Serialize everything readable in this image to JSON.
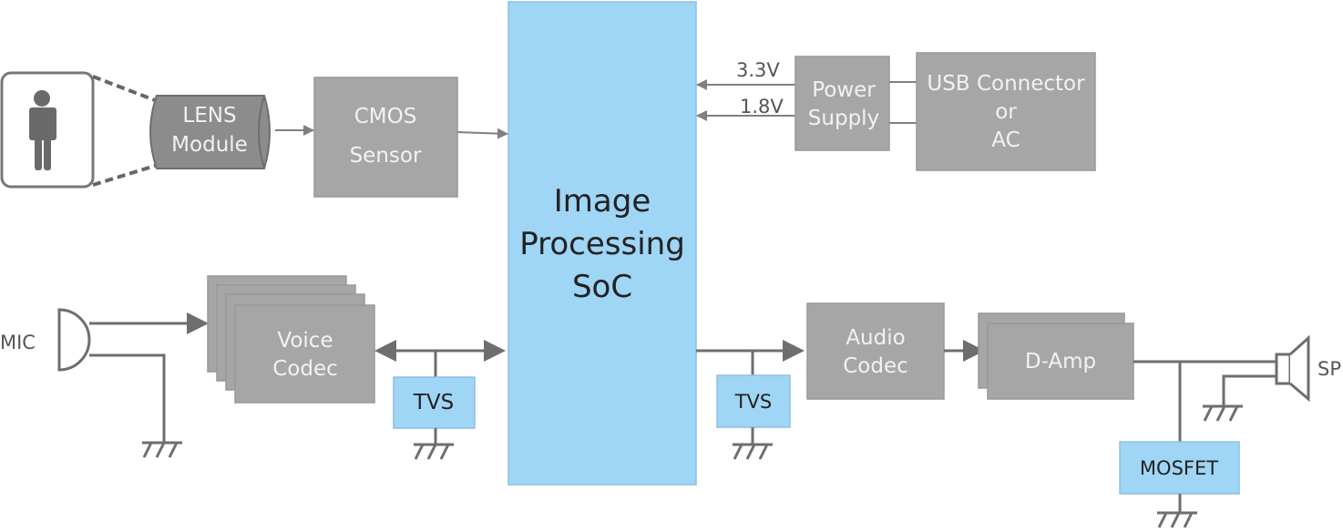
{
  "colors": {
    "block_gray": "#a6a6a6",
    "block_blue": "#9fd5f5",
    "line": "#6e6e6e"
  },
  "blocks": {
    "lens": [
      "LENS",
      "Module"
    ],
    "cmos": [
      "CMOS",
      "Sensor"
    ],
    "soc": [
      "Image",
      "Processing",
      "SoC"
    ],
    "power": [
      "Power",
      "Supply"
    ],
    "usb": [
      "USB Connector",
      "or",
      "AC"
    ],
    "voice_codec": [
      "Voice",
      "Codec"
    ],
    "tvs_left": "TVS",
    "tvs_right": "TVS",
    "audio_codec": [
      "Audio",
      "Codec"
    ],
    "damp": "D-Amp",
    "mosfet": "MOSFET"
  },
  "labels": {
    "v33": "3.3V",
    "v18": "1.8V",
    "mic": "MIC",
    "sp": "SP"
  },
  "icons": [
    "person-icon",
    "microphone-icon",
    "speaker-icon",
    "ground-icon"
  ]
}
